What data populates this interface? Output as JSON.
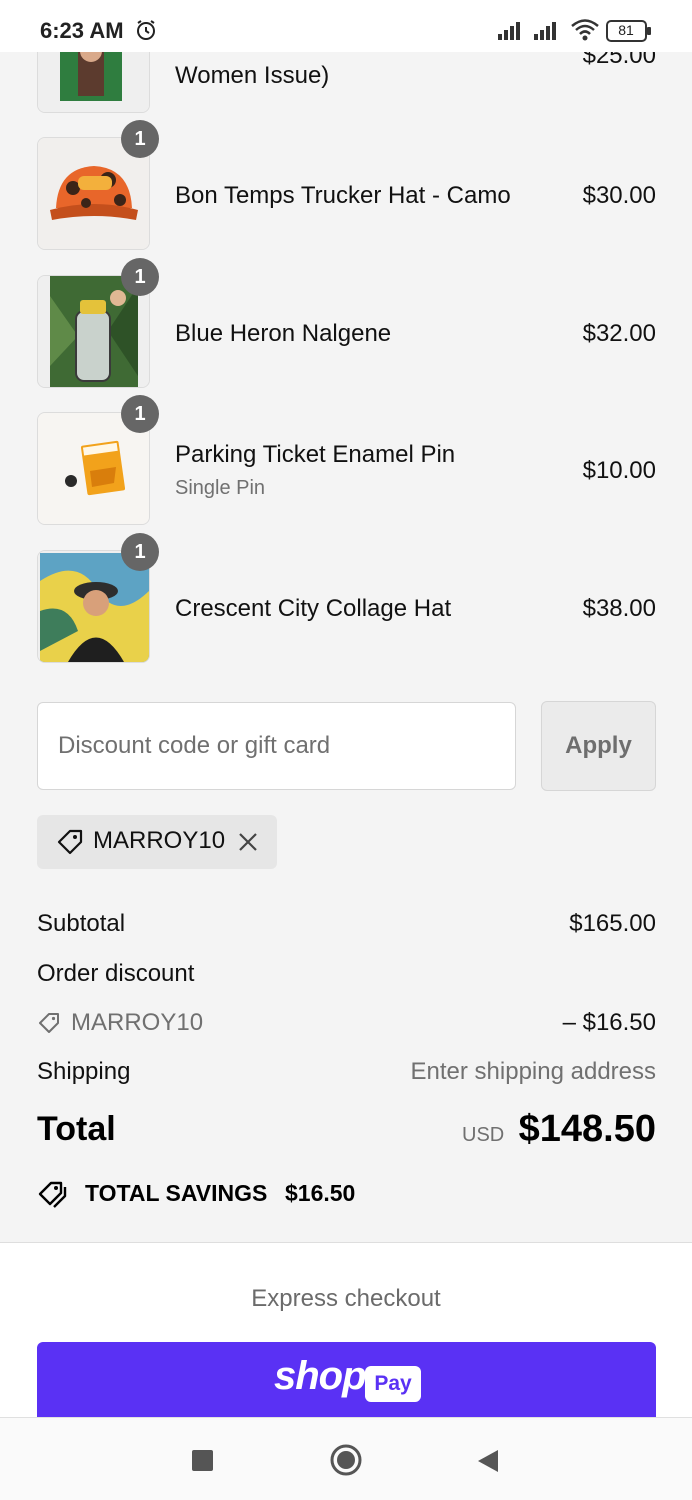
{
  "status_bar": {
    "time": "6:23 AM",
    "battery": "81"
  },
  "products": [
    {
      "name": "Women Issue)",
      "price": "$25.00",
      "image": "woman-photo",
      "partial": true
    },
    {
      "name": "Bon Temps Trucker Hat - Camo",
      "price": "$30.00",
      "qty": "1",
      "image": "camo-hat"
    },
    {
      "name": "Blue Heron Nalgene",
      "price": "$32.00",
      "qty": "1",
      "image": "nalgene-bottle"
    },
    {
      "name": "Parking Ticket Enamel Pin",
      "variant": "Single Pin",
      "price": "$10.00",
      "qty": "1",
      "image": "enamel-pin"
    },
    {
      "name": "Crescent City Collage Hat",
      "price": "$38.00",
      "qty": "1",
      "image": "collage-hat-photo"
    }
  ],
  "discount": {
    "placeholder": "Discount code or gift card",
    "apply_label": "Apply",
    "applied_code": "MARROY10"
  },
  "summary": {
    "subtotal_label": "Subtotal",
    "subtotal_value": "$165.00",
    "order_discount_label": "Order discount",
    "discount_code": "MARROY10",
    "discount_value": "– $16.50",
    "shipping_label": "Shipping",
    "shipping_value": "Enter shipping address",
    "total_label": "Total",
    "currency": "USD",
    "total_value": "$148.50",
    "savings_label": "TOTAL SAVINGS",
    "savings_value": "$16.50"
  },
  "express": {
    "title": "Express checkout",
    "shop_word": "shop",
    "pay_word": "Pay",
    "brand_color": "#5a31f4"
  },
  "icons": [
    "alarm-icon",
    "signal-icon",
    "wifi-icon",
    "battery-icon",
    "tag-icon",
    "close-icon",
    "savings-tag-icon",
    "nav-square-icon",
    "nav-home-icon",
    "nav-back-icon"
  ]
}
